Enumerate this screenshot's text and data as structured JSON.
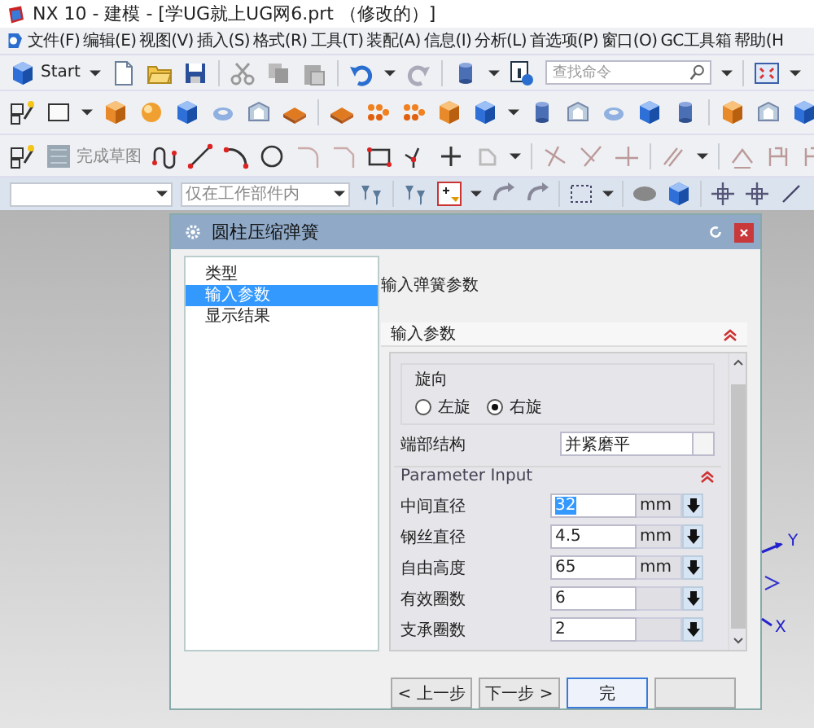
{
  "window": {
    "title": "NX 10 - 建模 - [学UG就上UG网6.prt （修改的）]"
  },
  "menu": [
    "文件(F)",
    "编辑(E)",
    "视图(V)",
    "插入(S)",
    "格式(R)",
    "工具(T)",
    "装配(A)",
    "信息(I)",
    "分析(L)",
    "首选项(P)",
    "窗口(O)",
    "GC工具箱",
    "帮助(H"
  ],
  "toolbar": {
    "start_label": "Start",
    "search": {
      "placeholder": "查找命令"
    }
  },
  "sketch_toolbar": {
    "finish_label": "完成草图"
  },
  "selection_bar": {
    "scope": "仅在工作部件内"
  },
  "dialog": {
    "title": "圆柱压缩弹簧",
    "steps": [
      {
        "label": "类型",
        "selected": false
      },
      {
        "label": "输入参数",
        "selected": true
      },
      {
        "label": "显示结果",
        "selected": false
      }
    ],
    "heading": "输入弹簧参数",
    "group_title": "输入参数",
    "direction": {
      "label": "旋向",
      "options": [
        {
          "label": "左旋",
          "selected": false
        },
        {
          "label": "右旋",
          "selected": true
        }
      ]
    },
    "end_structure": {
      "label": "端部结构",
      "value": "并紧磨平"
    },
    "section_title": "Parameter Input",
    "params": [
      {
        "label": "中间直径",
        "value": "32",
        "unit": "mm",
        "selected": true
      },
      {
        "label": "钢丝直径",
        "value": "4.5",
        "unit": "mm",
        "selected": false
      },
      {
        "label": "自由高度",
        "value": "65",
        "unit": "mm",
        "selected": false
      },
      {
        "label": "有效圈数",
        "value": "6",
        "selected": false
      },
      {
        "label": "支承圈数",
        "value": "2",
        "selected": false
      }
    ],
    "buttons": [
      {
        "label": "< 上一步",
        "default": false
      },
      {
        "label": "下一步 >",
        "default": false
      },
      {
        "label": "完",
        "default": true
      },
      {
        "default": false
      }
    ]
  },
  "axes": {
    "y_label": "Y",
    "x_label": "X"
  }
}
